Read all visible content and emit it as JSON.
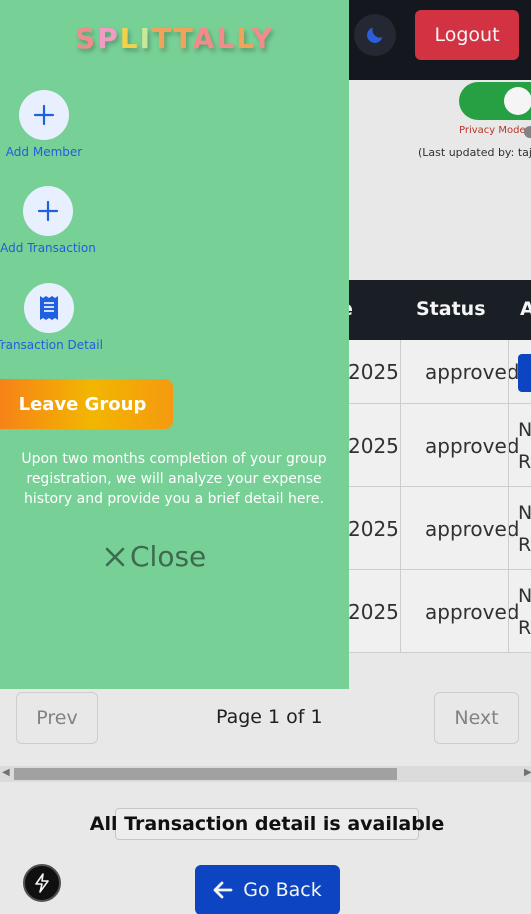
{
  "brand": {
    "letters": [
      "S",
      "P",
      "L",
      "I",
      "T",
      "T",
      "A",
      "L",
      "L",
      "Y"
    ],
    "letter_colors": [
      "#f28b8b",
      "#f29bc4",
      "#f2d24a",
      "#c9e89a",
      "#f2a35a",
      "#f2a35a",
      "#f28b8b",
      "#f28b8b",
      "#f2a35a",
      "#f28b8b"
    ]
  },
  "header": {
    "logout_label": "Logout"
  },
  "privacy": {
    "label": "Privacy Mode",
    "last_updated": "(Last updated by: taj"
  },
  "table": {
    "headers": {
      "date": "e",
      "status": "Status",
      "action": "A"
    },
    "rows": [
      {
        "date": "2025",
        "status": "approved",
        "action": [
          "",
          ""
        ]
      },
      {
        "date": "2025",
        "status": "approved",
        "action": [
          "N",
          "R"
        ]
      },
      {
        "date": "2025",
        "status": "approved",
        "action": [
          "N",
          "R"
        ]
      },
      {
        "date": "2025",
        "status": "approved",
        "action": [
          "N",
          "R"
        ]
      }
    ]
  },
  "pagination": {
    "prev_label": "Prev",
    "page_info": "Page 1 of 1",
    "next_label": "Next"
  },
  "footer": {
    "all_detail": "All Transaction detail is available",
    "go_back_label": "Go Back"
  },
  "drawer": {
    "add_member_label": "Add Member",
    "add_transaction_label": "Add Transaction",
    "transaction_detail_label": "Transaction Detail",
    "leave_group_label": "Leave Group",
    "note": "Upon two months completion of your group registration, we will analyze your expense history and provide you a brief detail here.",
    "close_label": "Close"
  },
  "colors": {
    "drawer_bg": "#77d095",
    "accent_blue": "#1f5fe0",
    "logout_red": "#dc3545",
    "go_back_blue": "#0d47c9",
    "toggle_green": "#28a745"
  },
  "icons": {
    "moon": "moon-icon",
    "plus": "plus-icon",
    "receipt": "receipt-icon",
    "close": "close-icon",
    "arrow": "arrow-left-icon",
    "bolt": "bolt-icon"
  }
}
